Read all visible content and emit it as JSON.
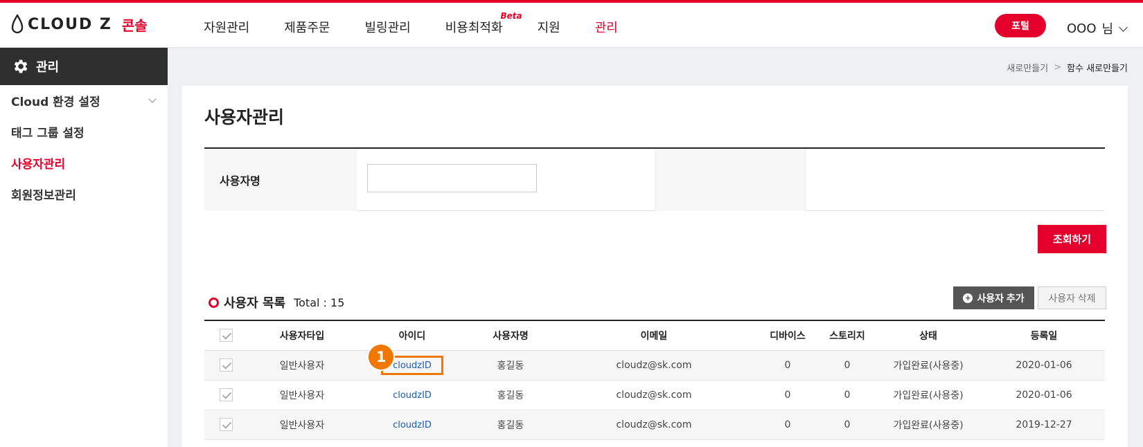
{
  "header": {
    "logo_text": "CLOUD Z",
    "logo_sub": "콘솔",
    "nav": [
      {
        "label": "자원관리"
      },
      {
        "label": "제품주문"
      },
      {
        "label": "빌링관리"
      },
      {
        "label": "비용최적화",
        "badge": "Beta"
      },
      {
        "label": "지원"
      },
      {
        "label": "관리"
      }
    ],
    "portal_label": "포털",
    "user_name": "OOO",
    "user_suffix": "님"
  },
  "sidebar": {
    "title": "관리",
    "items": [
      {
        "label": "Cloud 환경 설정"
      },
      {
        "label": "태그 그룹 설정"
      },
      {
        "label": "사용자관리"
      },
      {
        "label": "회원정보관리"
      }
    ]
  },
  "breadcrumb": {
    "parent": "새로만들기",
    "separator": ">",
    "current": "함수 새로만들기"
  },
  "main": {
    "title": "사용자관리",
    "search": {
      "label": "사용자명",
      "value": "",
      "placeholder": ""
    },
    "query_button": "조회하기",
    "list_title": "사용자 목록",
    "total_label": "Total : 15",
    "add_button": "사용자 추가",
    "delete_button": "사용자 삭제",
    "columns": [
      "사용자타입",
      "아이디",
      "사용자명",
      "이메일",
      "디바이스",
      "스토리지",
      "상태",
      "등록일"
    ],
    "rows": [
      {
        "type": "일반사용자",
        "id": "cloudzID",
        "name": "홍길동",
        "email": "cloudz@sk.com",
        "devices": "0",
        "storage": "0",
        "status": "가입완료(사용중)",
        "date": "2020-01-06"
      },
      {
        "type": "일반사용자",
        "id": "cloudzID",
        "name": "홍길동",
        "email": "cloudz@sk.com",
        "devices": "0",
        "storage": "0",
        "status": "가입완료(사용중)",
        "date": "2020-01-06"
      },
      {
        "type": "일반사용자",
        "id": "cloudzID",
        "name": "홍길동",
        "email": "cloudz@sk.com",
        "devices": "0",
        "storage": "0",
        "status": "가입완료(사용중)",
        "date": "2019-12-27"
      }
    ],
    "annotation_number": "1"
  },
  "colors": {
    "accent": "#e4002b",
    "annotation": "#f07800",
    "sidebar_header": "#2f2f2f"
  }
}
